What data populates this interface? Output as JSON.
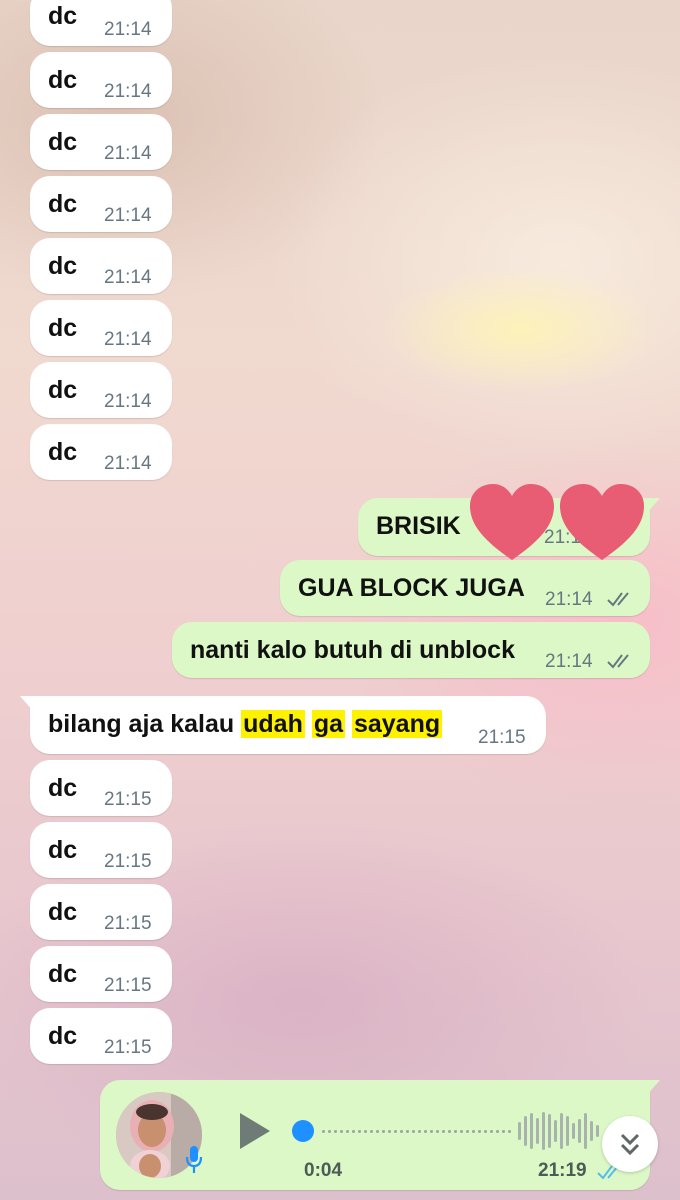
{
  "messages": [
    {
      "dir": "in",
      "text": "dc",
      "time": "21:14"
    },
    {
      "dir": "in",
      "text": "dc",
      "time": "21:14"
    },
    {
      "dir": "in",
      "text": "dc",
      "time": "21:14"
    },
    {
      "dir": "in",
      "text": "dc",
      "time": "21:14"
    },
    {
      "dir": "in",
      "text": "dc",
      "time": "21:14"
    },
    {
      "dir": "in",
      "text": "dc",
      "time": "21:14"
    },
    {
      "dir": "in",
      "text": "dc",
      "time": "21:14"
    },
    {
      "dir": "in",
      "text": "dc",
      "time": "21:14"
    },
    {
      "dir": "out",
      "text": "BRISIK",
      "time": "21:14"
    },
    {
      "dir": "out",
      "text": "GUA BLOCK JUGA",
      "time": "21:14"
    },
    {
      "dir": "out",
      "text": "nanti kalo butuh di unblock",
      "time": "21:14"
    },
    {
      "dir": "in",
      "text_parts": [
        "bilang aja kalau ",
        "udah",
        " ",
        "ga",
        " ",
        "sayang"
      ],
      "time": "21:15"
    },
    {
      "dir": "in",
      "text": "dc",
      "time": "21:15"
    },
    {
      "dir": "in",
      "text": "dc",
      "time": "21:15"
    },
    {
      "dir": "in",
      "text": "dc",
      "time": "21:15"
    },
    {
      "dir": "in",
      "text": "dc",
      "time": "21:15"
    },
    {
      "dir": "in",
      "text": "dc",
      "time": "21:15"
    }
  ],
  "voice_note": {
    "duration": "0:04",
    "time": "21:19",
    "progress": 0
  },
  "colors": {
    "incoming_bubble": "#ffffff",
    "outgoing_bubble": "#dcf8c6",
    "highlight": "#fff200",
    "heart": "#e85c74",
    "read_ticks": "#53bdeb",
    "sent_ticks": "#667781"
  },
  "icons": {
    "hearts": "heart-icon",
    "play": "play-icon",
    "mic": "mic-icon",
    "scroll": "double-chevron-down-icon"
  }
}
